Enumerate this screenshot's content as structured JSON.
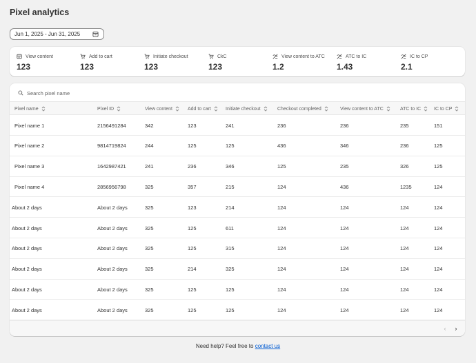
{
  "page": {
    "title": "Pixel analytics"
  },
  "date_range": {
    "label": "Jun 1, 2025 - Jun 31, 2025"
  },
  "metrics": [
    {
      "label": "View content",
      "value": "123",
      "icon": "view-content-icon"
    },
    {
      "label": "Add to cart",
      "value": "123",
      "icon": "cart-icon"
    },
    {
      "label": "Initiate checkout",
      "value": "123",
      "icon": "cart-icon"
    },
    {
      "label": "CkC",
      "value": "123",
      "icon": "cart-icon"
    },
    {
      "label": "View content to ATC",
      "value": "1.2",
      "icon": "ratio-icon"
    },
    {
      "label": "ATC to IC",
      "value": "1.43",
      "icon": "ratio-icon"
    },
    {
      "label": "IC to CP",
      "value": "2.1",
      "icon": "ratio-icon"
    }
  ],
  "search": {
    "placeholder": "Search pixel name"
  },
  "table": {
    "columns": [
      "Pixel name",
      "Pixel ID",
      "View content",
      "Add to cart",
      "Initiate checkout",
      "Checkout completed",
      "View content to ATC",
      "ATC to IC",
      "IC to CP"
    ],
    "rows": [
      [
        "Pixel name 1",
        "2156491284",
        "342",
        "123",
        "241",
        "236",
        "236",
        "235",
        "151"
      ],
      [
        "Pixel name 2",
        "9814719824",
        "244",
        "125",
        "125",
        "436",
        "346",
        "236",
        "125"
      ],
      [
        "Pixel name 3",
        "1642987421",
        "241",
        "236",
        "346",
        "125",
        "235",
        "326",
        "125"
      ],
      [
        "Pixel name 4",
        "2856956798",
        "325",
        "357",
        "215",
        "124",
        "436",
        "1235",
        "124"
      ],
      [
        "About 2 days",
        "About 2 days",
        "325",
        "123",
        "214",
        "124",
        "124",
        "124",
        "124"
      ],
      [
        "About 2 days",
        "About 2 days",
        "325",
        "125",
        "611",
        "124",
        "124",
        "124",
        "124"
      ],
      [
        "About 2 days",
        "About 2 days",
        "325",
        "125",
        "315",
        "124",
        "124",
        "124",
        "124"
      ],
      [
        "About 2 days",
        "About 2 days",
        "325",
        "214",
        "325",
        "124",
        "124",
        "124",
        "124"
      ],
      [
        "About 2 days",
        "About 2 days",
        "325",
        "125",
        "125",
        "124",
        "124",
        "124",
        "124"
      ],
      [
        "About 2 days",
        "About 2 days",
        "325",
        "125",
        "125",
        "124",
        "124",
        "124",
        "124"
      ]
    ]
  },
  "pagination": {
    "prev": "‹",
    "next": "›"
  },
  "help": {
    "text": "Need help? Feel free to ",
    "link": "contact us"
  },
  "colors": {
    "link": "#005bd3",
    "background": "#f1f1f1",
    "card": "#ffffff"
  }
}
